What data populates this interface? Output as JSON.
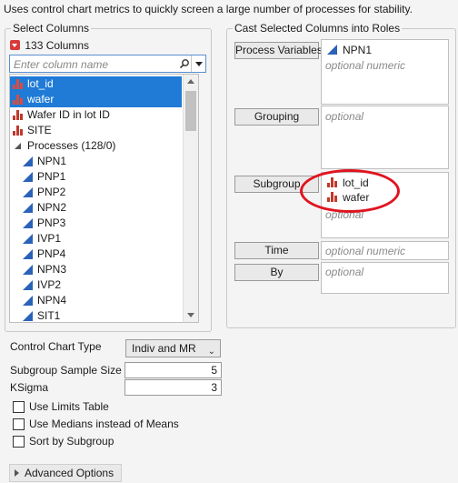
{
  "intro_text": "Uses control chart metrics to quickly screen a large number of processes for stability.",
  "select_columns": {
    "title": "Select Columns",
    "count_label": "133 Columns",
    "search_placeholder": "Enter column name",
    "items": [
      {
        "label": "lot_id",
        "type": "nominal",
        "selected": true
      },
      {
        "label": "wafer",
        "type": "nominal",
        "selected": true
      },
      {
        "label": "Wafer ID in lot ID",
        "type": "nominal",
        "selected": false
      },
      {
        "label": "SITE",
        "type": "nominal",
        "selected": false
      },
      {
        "label": "Processes (128/0)",
        "type": "group",
        "selected": false
      },
      {
        "label": "NPN1",
        "type": "numeric",
        "selected": false
      },
      {
        "label": "PNP1",
        "type": "numeric",
        "selected": false
      },
      {
        "label": "PNP2",
        "type": "numeric",
        "selected": false
      },
      {
        "label": "NPN2",
        "type": "numeric",
        "selected": false
      },
      {
        "label": "PNP3",
        "type": "numeric",
        "selected": false
      },
      {
        "label": "IVP1",
        "type": "numeric",
        "selected": false
      },
      {
        "label": "PNP4",
        "type": "numeric",
        "selected": false
      },
      {
        "label": "NPN3",
        "type": "numeric",
        "selected": false
      },
      {
        "label": "IVP2",
        "type": "numeric",
        "selected": false
      },
      {
        "label": "NPN4",
        "type": "numeric",
        "selected": false
      },
      {
        "label": "SIT1",
        "type": "numeric",
        "selected": false
      }
    ]
  },
  "roles": {
    "title": "Cast Selected Columns into Roles",
    "process_variables": {
      "label": "Process Variables",
      "items": [
        "NPN1"
      ],
      "hint": "optional numeric"
    },
    "grouping": {
      "label": "Grouping",
      "hint": "optional"
    },
    "subgroup": {
      "label": "Subgroup",
      "items": [
        "lot_id",
        "wafer"
      ],
      "hint": "optional"
    },
    "time": {
      "label": "Time",
      "hint": "optional numeric"
    },
    "by": {
      "label": "By",
      "hint": "optional"
    }
  },
  "options": {
    "control_chart_type_label": "Control Chart Type",
    "control_chart_type_value": "Indiv and MR",
    "subgroup_sample_size_label": "Subgroup Sample Size",
    "subgroup_sample_size_value": "5",
    "ksigma_label": "KSigma",
    "ksigma_value": "3",
    "use_limits_table": "Use Limits Table",
    "use_medians": "Use Medians instead of Means",
    "sort_by_subgroup": "Sort by Subgroup",
    "advanced_options": "Advanced Options"
  },
  "colors": {
    "selection": "#1f7bd6",
    "nominal_icon": "#c0392b",
    "numeric_icon": "#2a62b8",
    "highlight_ellipse": "#e0141e"
  }
}
